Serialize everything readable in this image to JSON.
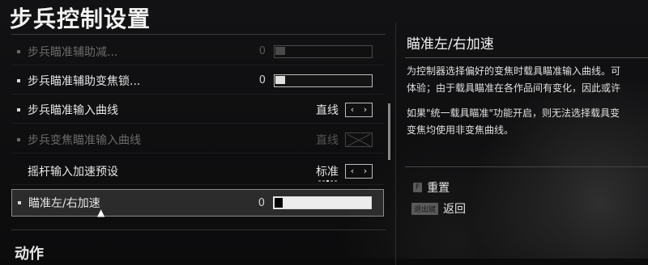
{
  "header": {
    "title": "步兵控制设置"
  },
  "settings": [
    {
      "label": "步兵瞄准辅助减...",
      "type": "slider",
      "value": "0",
      "disabled": true,
      "selected": false
    },
    {
      "label": "步兵瞄准辅助变焦锁...",
      "type": "slider",
      "value": "0",
      "disabled": false,
      "selected": false
    },
    {
      "label": "步兵瞄准输入曲线",
      "type": "option",
      "value": "直线",
      "disabled": false,
      "selected": false
    },
    {
      "label": "步兵变焦瞄准输入曲线",
      "type": "option",
      "value": "直线",
      "disabled": true,
      "selected": false
    },
    {
      "label": "摇杆输入加速预设",
      "type": "option",
      "value": "标准",
      "disabled": false,
      "selected": false
    },
    {
      "label": "瞄准左/右加速",
      "type": "slider",
      "value": "0",
      "disabled": false,
      "selected": true
    }
  ],
  "next_section": {
    "title": "动作"
  },
  "detail": {
    "title": "瞄准左/右加速",
    "desc_line1": "为控制器选择偏好的变焦时载具瞄准输入曲线。可",
    "desc_line2": "体验；由于载具瞄准在各作品间有变化，因此或许",
    "desc_line3": "如果\"统一载具瞄准\"功能开启，则无法选择载具变",
    "desc_line4": "变焦均使用非变焦曲线。"
  },
  "actions": {
    "reset": {
      "key": "F",
      "label": "重置"
    },
    "back": {
      "key": "退出键",
      "label": "返回"
    }
  },
  "icons": {
    "prev": "‹",
    "next": "›"
  }
}
